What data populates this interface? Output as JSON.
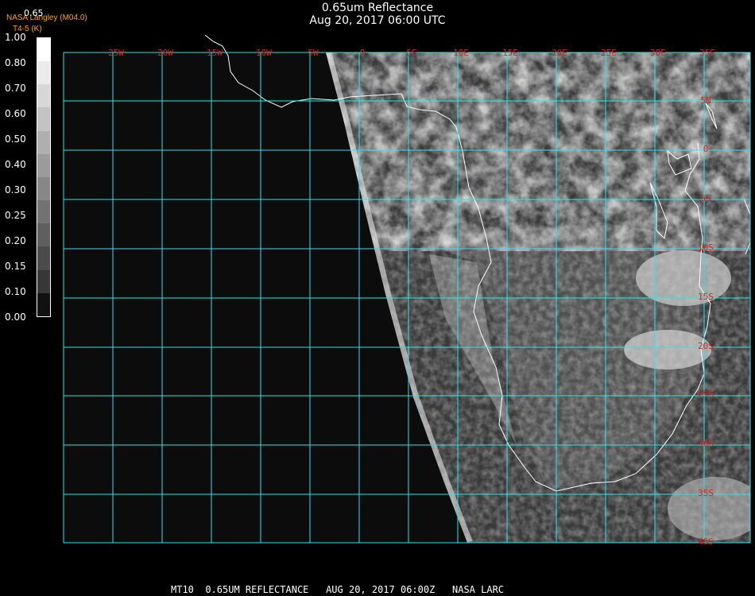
{
  "header": {
    "title": "0.65um Reflectance",
    "datetime": "Aug 20, 2017 06:00 UTC",
    "credit": "NASA Langley (M04.0)",
    "subcredit": "T4-5 (K)",
    "scale_top": "0.65"
  },
  "colorbar": {
    "labels": [
      "1.00",
      "0.80",
      "0.70",
      "0.60",
      "0.50",
      "0.40",
      "0.30",
      "0.25",
      "0.20",
      "0.15",
      "0.10",
      "0.00"
    ],
    "colors": [
      "#ffffff",
      "#ebebeb",
      "#d7d7d7",
      "#c3c3c3",
      "#afafaf",
      "#9b9b9b",
      "#878787",
      "#737373",
      "#5f5f5f",
      "#4b4b4b",
      "#373737",
      "#111111"
    ]
  },
  "map": {
    "grid_color": "#2ee6e6",
    "coast_color": "#ffffff",
    "label_color": "#dd2222",
    "lon_labels": [
      "25W",
      "20W",
      "15W",
      "10W",
      "5W",
      "0",
      "5E",
      "10E",
      "15E",
      "20E",
      "25E",
      "30E",
      "35E"
    ],
    "lat_labels": [
      "5N",
      "0",
      "5S",
      "10S",
      "15S",
      "20S",
      "25S",
      "30S",
      "35S",
      "40S"
    ]
  },
  "footer": {
    "text": "MT10  0.65UM REFLECTANCE   AUG 20, 2017 06:00Z   NASA LARC"
  }
}
